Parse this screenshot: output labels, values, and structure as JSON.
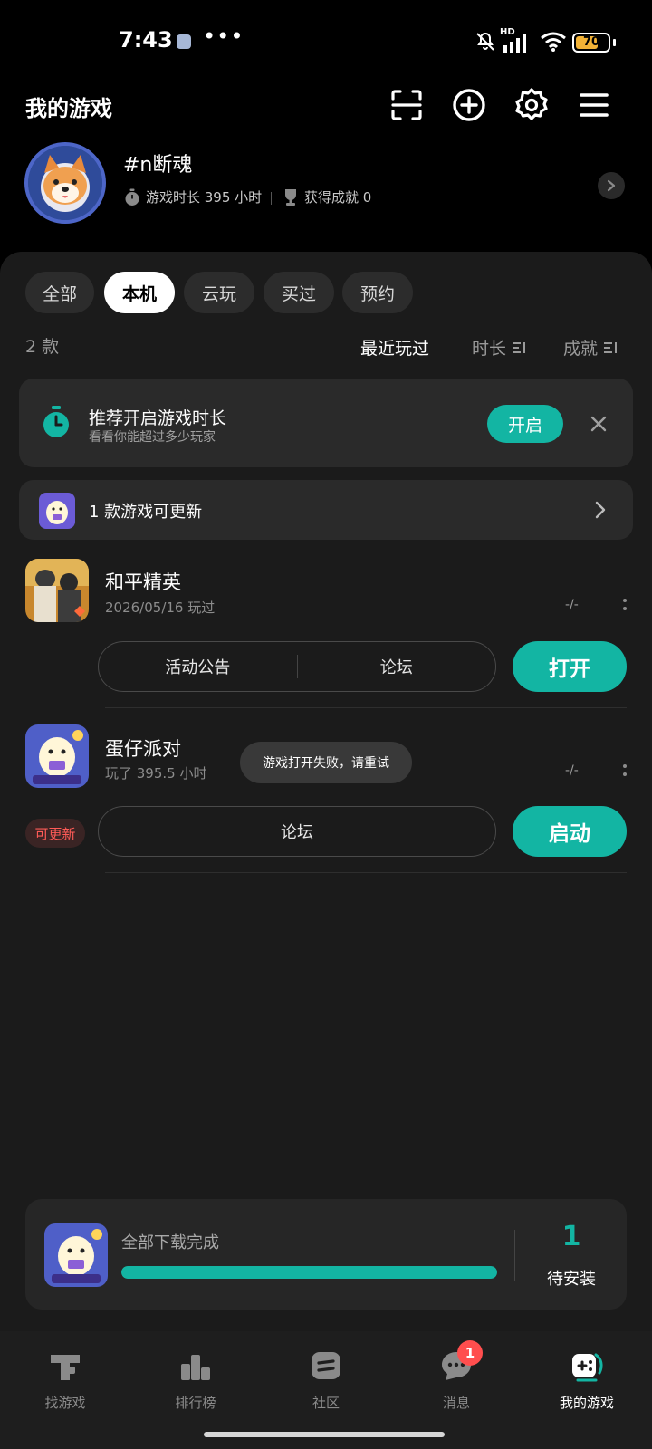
{
  "status_bar": {
    "time": "7:43",
    "more": "•••",
    "network": "HD",
    "battery": "70",
    "battery_level": 0.7
  },
  "header": {
    "title": "我的游戏",
    "icons": [
      "scan-icon",
      "add-icon",
      "settings-icon",
      "menu-icon"
    ]
  },
  "profile": {
    "username": "#n断魂",
    "playtime_label": "游戏时长 395 小时",
    "achievement_label": "获得成就 0"
  },
  "filters": [
    "全部",
    "本机",
    "云玩",
    "买过",
    "预约"
  ],
  "active_filter": "本机",
  "list_header": {
    "count": "2 款",
    "sort_recent": "最近玩过",
    "sort_duration": "时长",
    "sort_achievement": "成就"
  },
  "recommend": {
    "title": "推荐开启游戏时长",
    "subtitle": "看看你能超过多少玩家",
    "button": "开启"
  },
  "update_banner": {
    "text": "1 款游戏可更新"
  },
  "games": [
    {
      "name": "和平精英",
      "subtitle": "2026/05/16 玩过",
      "dash": "-/-",
      "actions": [
        "活动公告",
        "论坛"
      ],
      "primary": "打开"
    },
    {
      "name": "蛋仔派对",
      "subtitle": "玩了 395.5 小时",
      "dash": "-/-",
      "badge": "可更新",
      "actions": [
        "论坛"
      ],
      "primary": "启动"
    }
  ],
  "toast": "游戏打开失败，请重试",
  "download": {
    "title": "全部下载完成",
    "progress": 1.0,
    "count": "1",
    "label": "待安装"
  },
  "bottom_nav": [
    {
      "label": "找游戏",
      "icon": "find-game-icon"
    },
    {
      "label": "排行榜",
      "icon": "ranking-icon"
    },
    {
      "label": "社区",
      "icon": "community-icon"
    },
    {
      "label": "消息",
      "icon": "message-icon",
      "badge": "1"
    },
    {
      "label": "我的游戏",
      "icon": "my-games-icon",
      "active": true
    }
  ],
  "colors": {
    "accent": "#13b5a3",
    "background": "#000000",
    "panel": "#1b1b1b",
    "badge_red": "#ff4e4e"
  }
}
